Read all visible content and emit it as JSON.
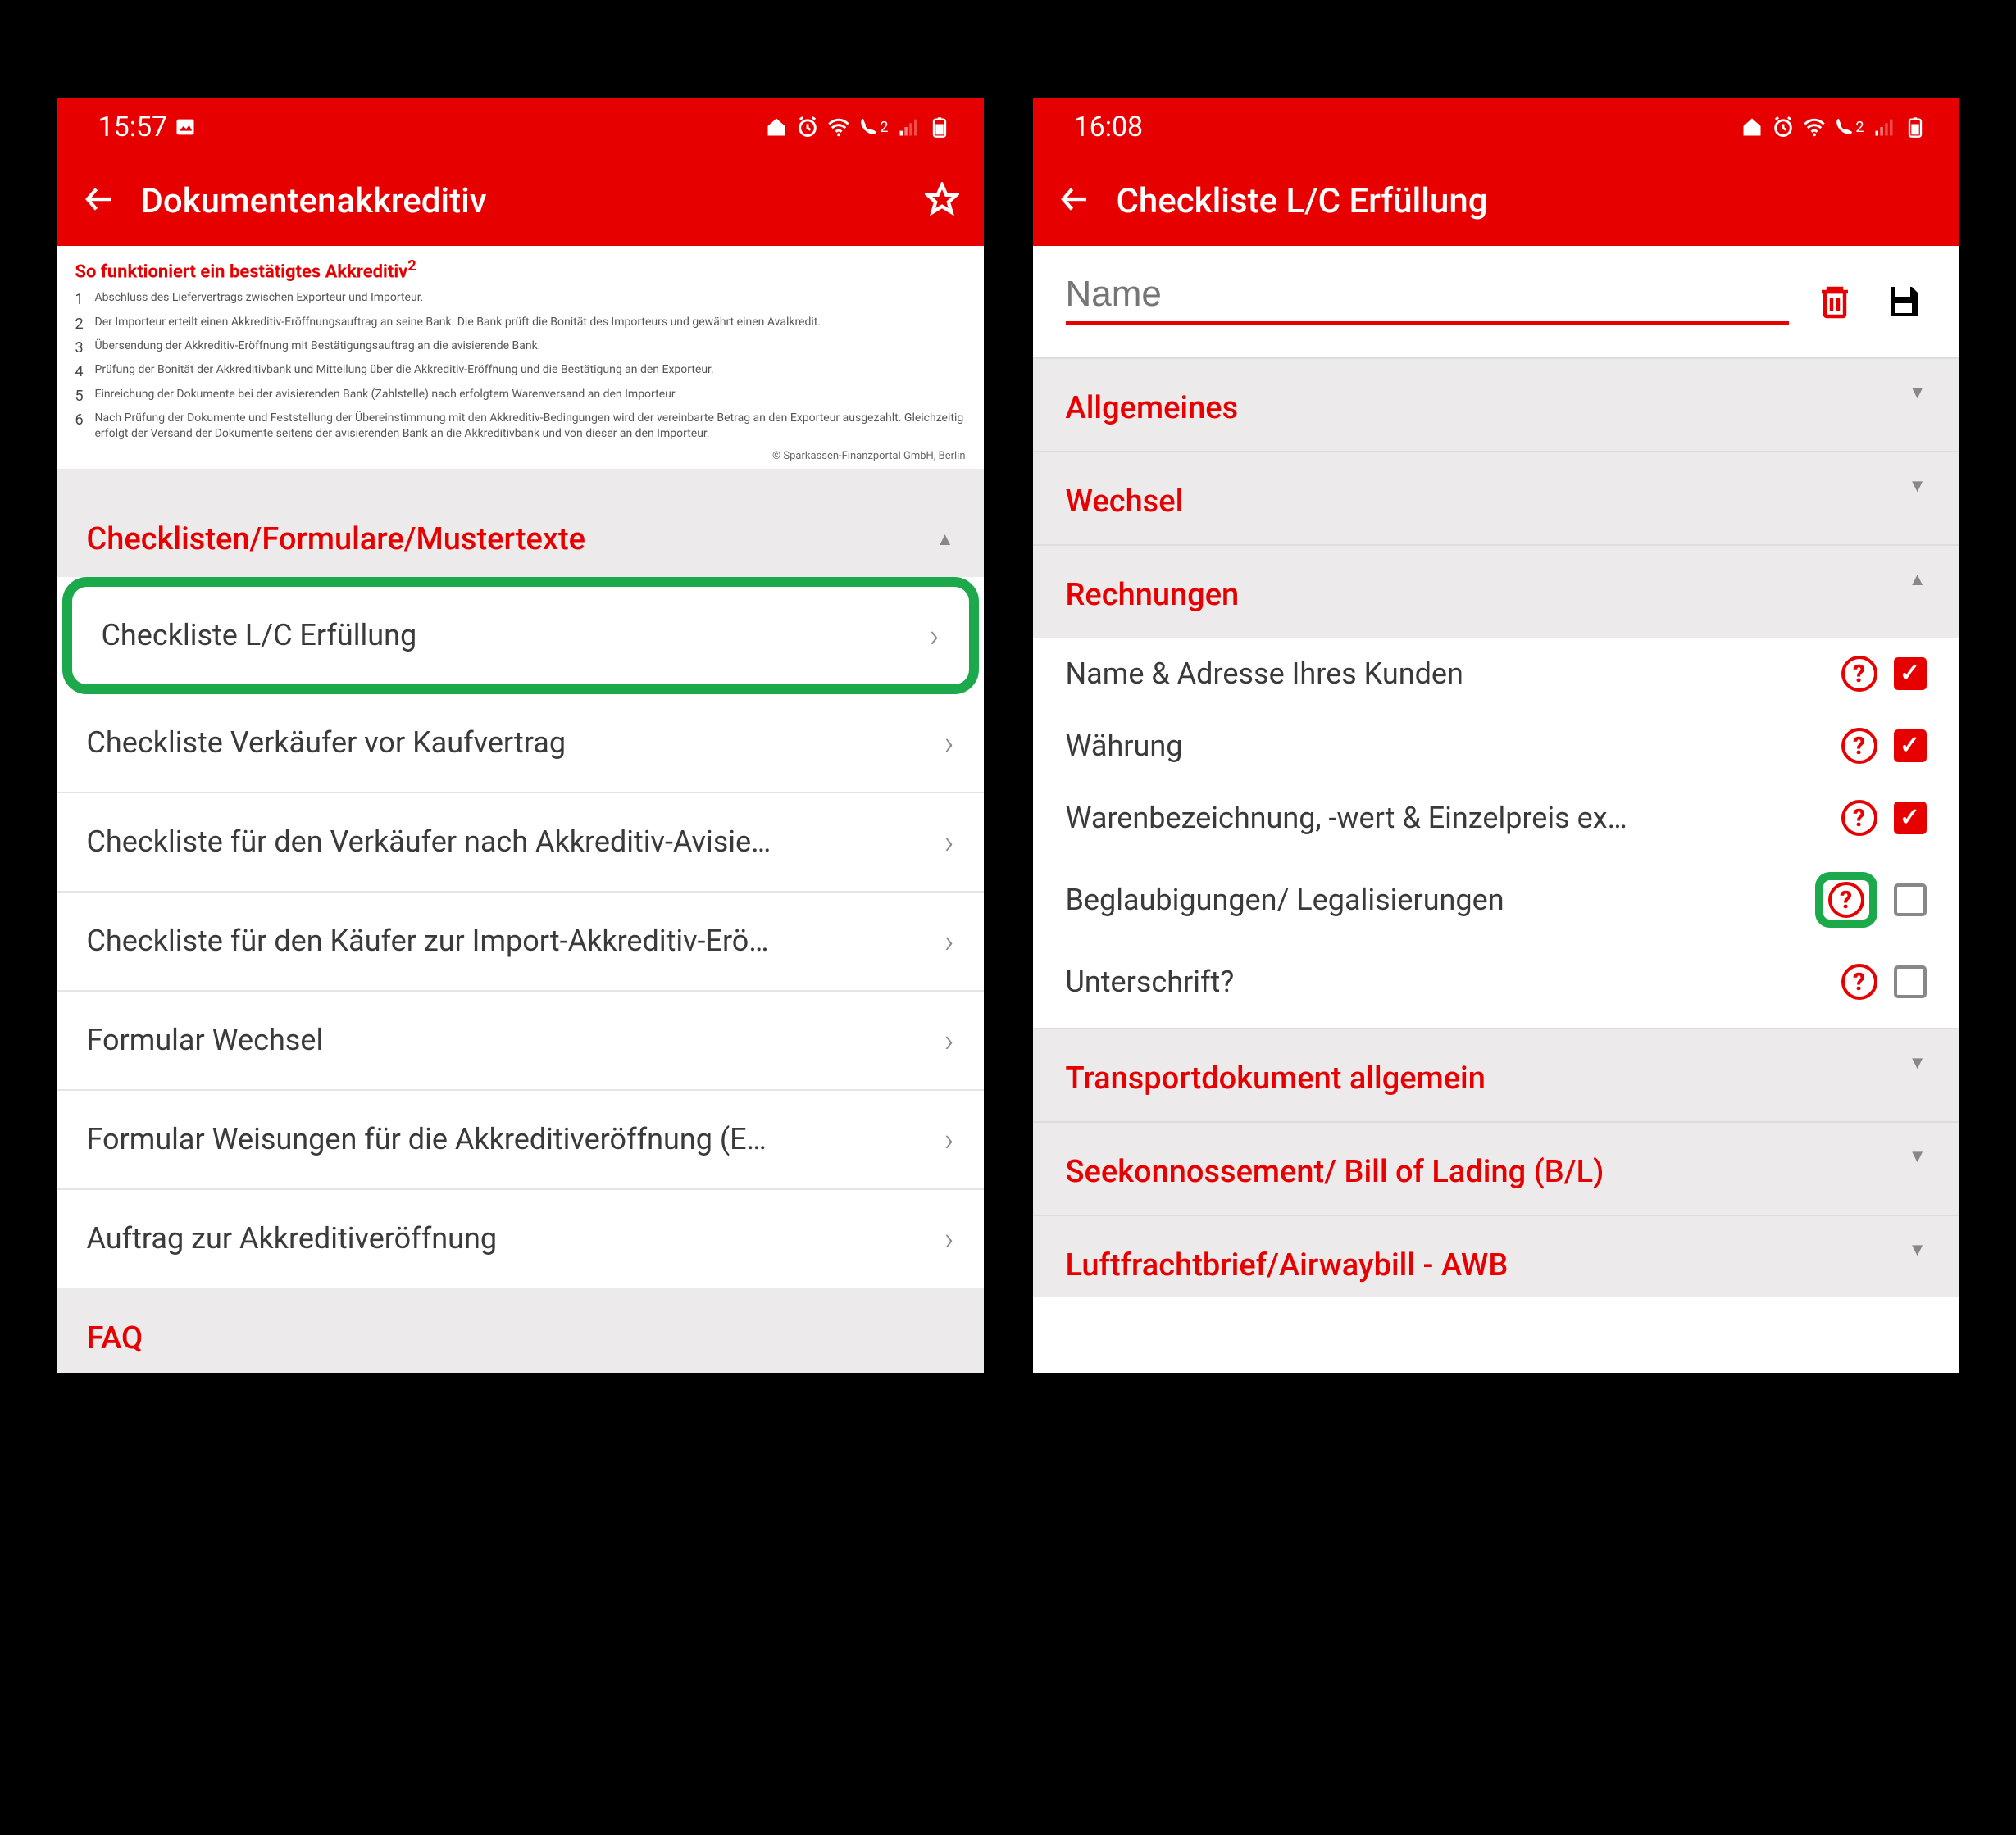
{
  "screens": {
    "left": {
      "status": {
        "time": "15:57",
        "phone_label": "2"
      },
      "title": "Dokumentenakkreditiv",
      "info": {
        "heading": "So funktioniert ein bestätigtes Akkreditiv",
        "heading_sup": "2",
        "steps": [
          "Abschluss des Liefervertrags zwischen Exporteur und Importeur.",
          "Der Importeur erteilt einen Akkreditiv-Eröffnungsauftrag an seine Bank. Die Bank prüft die Bonität des Importeurs und gewährt einen Avalkredit.",
          "Übersendung der Akkreditiv-Eröffnung mit Bestätigungsauftrag an die avisierende Bank.",
          "Prüfung der Bonität der Akkreditivbank und Mitteilung über die Akkreditiv-Eröffnung und die Bestätigung an den Exporteur.",
          "Einreichung der Dokumente bei der avisierenden Bank (Zahlstelle) nach erfolgtem Warenversand an den Importeur.",
          "Nach Prüfung der Dokumente und Feststellung der Übereinstimmung mit den Akkreditiv-Bedingungen wird der vereinbarte Betrag an den Exporteur ausgezahlt. Gleichzeitig erfolgt der Versand der Dokumente seitens der avisierenden Bank an die Akkreditivbank und von dieser an den Importeur."
        ],
        "copyright": "© Sparkassen-Finanzportal GmbH, Berlin"
      },
      "section_list_title": "Checklisten/Formulare/Mustertexte",
      "rows": [
        "Checkliste L/C Erfüllung",
        "Checkliste Verkäufer vor Kaufvertrag",
        "Checkliste für den Verkäufer nach Akkreditiv-Avisie…",
        "Checkliste für den Käufer zur Import-Akkreditiv-Erö…",
        "Formular Wechsel",
        "Formular Weisungen für die Akkreditiveröffnung (E…",
        "Auftrag zur Akkreditiveröffnung"
      ],
      "faq": "FAQ"
    },
    "right": {
      "status": {
        "time": "16:08",
        "phone_label": "2"
      },
      "title": "Checkliste L/C Erfüllung",
      "name_placeholder": "Name",
      "accordions": [
        {
          "label": "Allgemeines",
          "open": false
        },
        {
          "label": "Wechsel",
          "open": false
        },
        {
          "label": "Rechnungen",
          "open": true,
          "items": [
            {
              "label": "Name & Adresse Ihres Kunden",
              "checked": true,
              "highlight_help": false
            },
            {
              "label": "Währung",
              "checked": true,
              "highlight_help": false
            },
            {
              "label": "Warenbezeichnung, -wert & Einzelpreis ex…",
              "checked": true,
              "highlight_help": false
            },
            {
              "label": "Beglaubigungen/ Legalisierungen",
              "checked": false,
              "highlight_help": true
            },
            {
              "label": "Unterschrift?",
              "checked": false,
              "highlight_help": false
            }
          ]
        },
        {
          "label": "Transportdokument allgemein",
          "open": false
        },
        {
          "label": "Seekonnossement/ Bill of Lading (B/L)",
          "open": false
        },
        {
          "label": "Luftfrachtbrief/Airwaybill - AWB",
          "open": false
        }
      ]
    }
  }
}
